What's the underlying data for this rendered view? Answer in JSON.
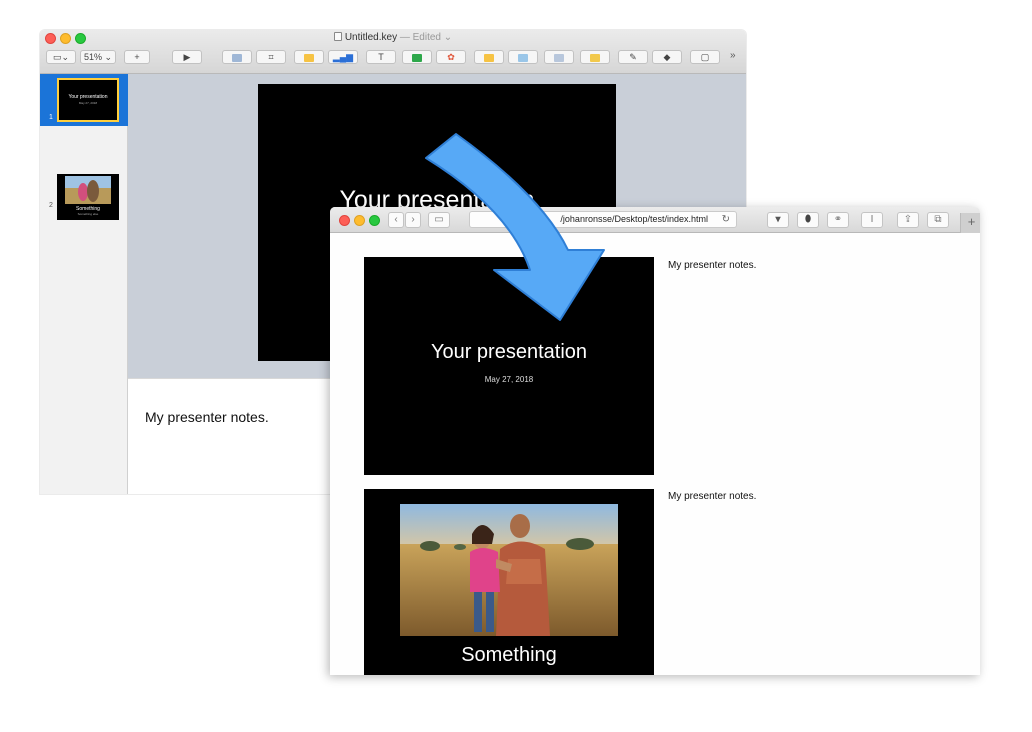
{
  "keynote": {
    "title": "Untitled.key",
    "edited": "— Edited ⌄",
    "zoom": "51%",
    "toolbar_icons": [
      "view-icon",
      "add-slide-icon",
      "play-icon",
      "table-icon",
      "chart-icon",
      "text-icon",
      "shape-icon",
      "media-icon",
      "comment-icon",
      "share-icon",
      "lock-icon",
      "format-icon",
      "animate-icon",
      "document-icon",
      "more-icon"
    ],
    "slides": [
      {
        "number": "1",
        "title": "Your presentation",
        "subtitle": "May 27, 2018"
      },
      {
        "number": "2",
        "title": "Something",
        "subtitle": "Something else"
      }
    ],
    "main_slide_title": "Your presentation",
    "presenter_notes": "My presenter notes."
  },
  "safari": {
    "url": "/johanronsse/Desktop/test/index.html",
    "slides": [
      {
        "title": "Your presentation",
        "date": "May 27, 2018",
        "notes": "My presenter notes."
      },
      {
        "title": "Something",
        "notes": "My presenter notes."
      }
    ]
  },
  "colors": {
    "arrow_fill": "#57a9f6",
    "arrow_stroke": "#2f7fd6",
    "selection": "#1b74d8",
    "slide_background": "#000000"
  }
}
